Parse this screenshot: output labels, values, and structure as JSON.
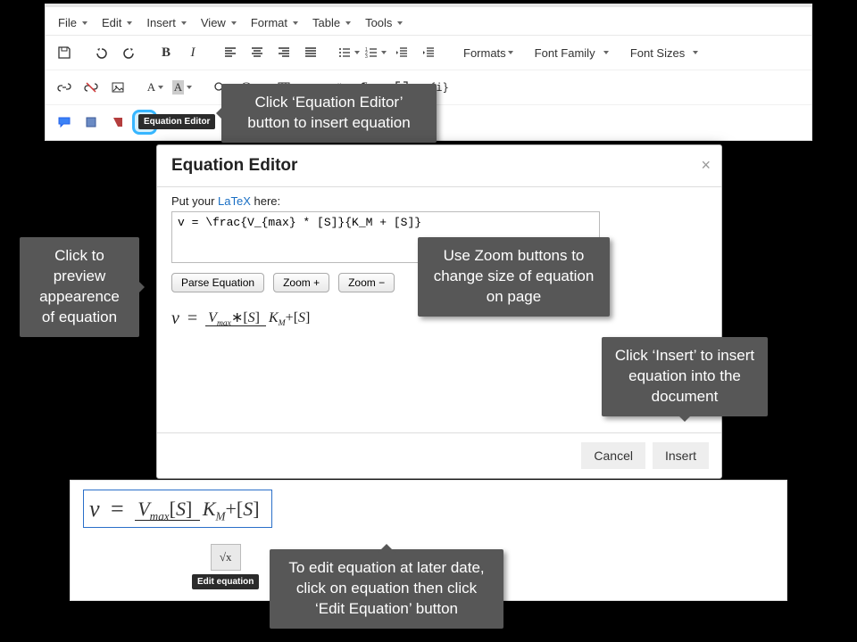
{
  "menubar": {
    "items": [
      "File",
      "Edit",
      "Insert",
      "View",
      "Format",
      "Table",
      "Tools"
    ]
  },
  "toolbar": {
    "dropdowns": {
      "formats": "Formats",
      "font_family": "Font Family",
      "font_sizes": "Font Sizes"
    }
  },
  "eq_button_tooltip": "Equation Editor",
  "callouts": {
    "eq_button": "Click ‘Equation Editor’ button to insert equation",
    "parse": "Click to preview appearence of equation",
    "zoom": "Use Zoom buttons to change size of equation on page",
    "insert": "Click ‘Insert’ to insert equation into the document",
    "edit": "To edit equation at later date, click on equation then click ‘Edit Equation’ button"
  },
  "dialog": {
    "title": "Equation Editor",
    "prompt_prefix": "Put your ",
    "prompt_link": "LaTeX",
    "prompt_suffix": " here:",
    "latex_value": "v = \\frac{V_{max} * [S]}{K_M + [S]}",
    "buttons": {
      "parse": "Parse Equation",
      "zoom_in": "Zoom +",
      "zoom_out": "Zoom −"
    },
    "footer": {
      "cancel": "Cancel",
      "insert": "Insert"
    }
  },
  "edit_tooltip": "Edit equation",
  "equation_display": {
    "lhs": "v",
    "eq": "=",
    "num_base1": "V",
    "num_sub1": "max",
    "num_op": "∗",
    "num_br1": "[",
    "num_sym": "S",
    "num_br2": "]",
    "den_base1": "K",
    "den_sub1": "M",
    "den_op": "+",
    "den_br1": "[",
    "den_sym": "S",
    "den_br2": "]"
  }
}
